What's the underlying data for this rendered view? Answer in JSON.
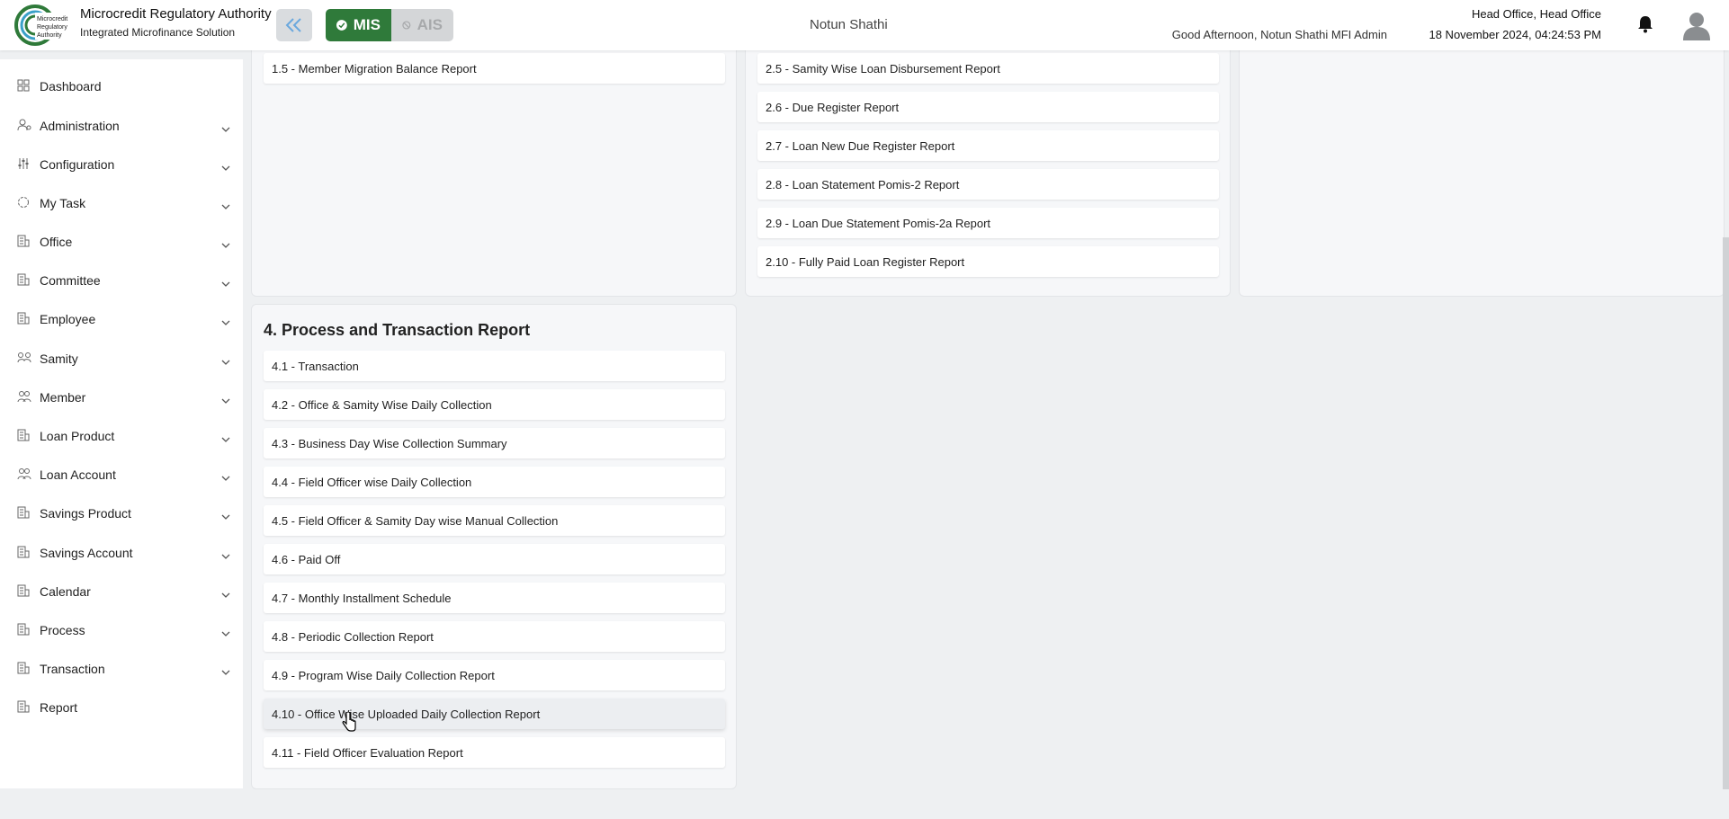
{
  "header": {
    "org_title": "Microcredit Regulatory Authority",
    "org_subtitle": "Integrated Microfinance Solution",
    "logo_text": "Microcredit Regulatory Authority",
    "mis_label": "MIS",
    "ais_label": "AIS",
    "center_title": "Notun Shathi",
    "greeting": "Good Afternoon, Notun Shathi MFI Admin",
    "office": "Head Office, Head Office",
    "datetime": "18 November 2024, 04:24:53 PM",
    "colors": {
      "brand_green": "#2f7a3a",
      "inactive": "#d4d6d8"
    }
  },
  "sidebar": {
    "items": [
      {
        "label": "Dashboard",
        "icon": "grid-icon"
      },
      {
        "label": "Administration",
        "icon": "users-cog-icon"
      },
      {
        "label": "Configuration",
        "icon": "sliders-icon"
      },
      {
        "label": "My Task",
        "icon": "task-circle-icon"
      },
      {
        "label": "Office",
        "icon": "building-icon"
      },
      {
        "label": "Committee",
        "icon": "building-icon"
      },
      {
        "label": "Employee",
        "icon": "building-icon"
      },
      {
        "label": "Samity",
        "icon": "group-icon"
      },
      {
        "label": "Member",
        "icon": "people-icon"
      },
      {
        "label": "Loan Product",
        "icon": "building-icon"
      },
      {
        "label": "Loan Account",
        "icon": "people-icon"
      },
      {
        "label": "Savings Product",
        "icon": "building-icon"
      },
      {
        "label": "Savings Account",
        "icon": "building-icon"
      },
      {
        "label": "Calendar",
        "icon": "building-icon"
      },
      {
        "label": "Process",
        "icon": "building-icon"
      },
      {
        "label": "Transaction",
        "icon": "building-icon"
      },
      {
        "label": "Report",
        "icon": "building-icon"
      }
    ]
  },
  "reports": {
    "col1_top": [
      "1.5 - Member Migration Balance Report"
    ],
    "col2_top": [
      "2.5 - Samity Wise Loan Disbursement Report",
      "2.6 - Due Register Report",
      "2.7 - Loan New Due Register Report",
      "2.8 - Loan Statement Pomis-2 Report",
      "2.9 - Loan Due Statement Pomis-2a Report",
      "2.10 - Fully Paid Loan Register Report"
    ],
    "section4_title": "4. Process and Transaction Report",
    "section4_items": [
      "4.1 - Transaction",
      "4.2 - Office & Samity Wise Daily Collection",
      "4.3 - Business Day Wise Collection Summary",
      "4.4 - Field Officer wise Daily Collection",
      "4.5 - Field Officer & Samity Day wise Manual Collection",
      "4.6 - Paid Off",
      "4.7 - Monthly Installment Schedule",
      "4.8 - Periodic Collection Report",
      "4.9 - Program Wise Daily Collection Report",
      "4.10 - Office Wise Uploaded Daily Collection Report",
      "4.11 - Field Officer Evaluation Report"
    ]
  }
}
